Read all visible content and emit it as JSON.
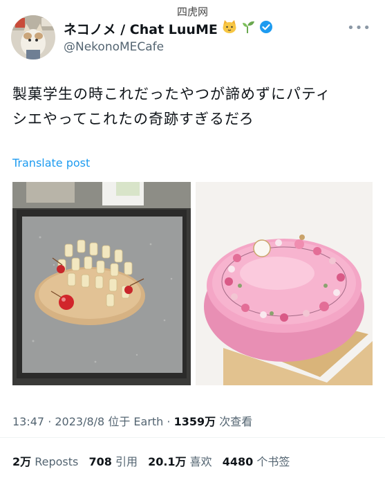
{
  "watermark": "四虎网",
  "author": {
    "display_name": "ネコノメ / Chat LuuME",
    "handle": "@NekonoMECafe",
    "verified": true,
    "badge_icons": [
      "cat-face-icon",
      "sprout-icon"
    ]
  },
  "tweet": {
    "line1": "製菓学生の時これだったやつが諦めずにパティ",
    "line2": "シエやってこれたの奇跡すぎるだろ",
    "translate_label": "Translate post"
  },
  "images": [
    {
      "name": "failed-cake-photo"
    },
    {
      "name": "pink-cake-photo"
    }
  ],
  "meta": {
    "time": "13:47",
    "date": "2023/8/8",
    "location": "位于 Earth",
    "views_count": "1359万",
    "views_label": "次查看"
  },
  "stats": {
    "reposts_count": "2万",
    "reposts_label": "Reposts",
    "quotes_count": "708",
    "quotes_label": "引用",
    "likes_count": "20.1万",
    "likes_label": "喜欢",
    "bookmarks_count": "4480",
    "bookmarks_label": "个书签"
  },
  "colors": {
    "link": "#1d9bf0",
    "secondary_text": "#536471",
    "verified": "#1d9bf0"
  }
}
